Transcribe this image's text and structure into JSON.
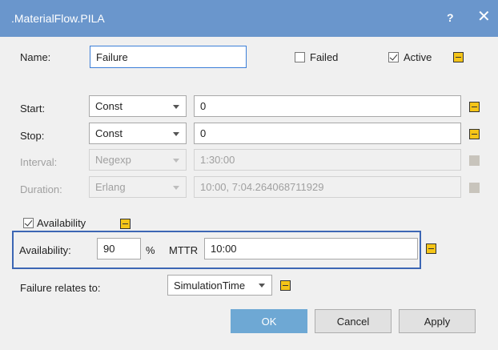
{
  "window": {
    "title": ".MaterialFlow.PILA",
    "help_label": "?",
    "close_label": "✕"
  },
  "name": {
    "label": "Name:",
    "value": "Failure"
  },
  "failed": {
    "label": "Failed",
    "checked": false
  },
  "active": {
    "label": "Active",
    "checked": true
  },
  "start": {
    "label": "Start:",
    "mode": "Const",
    "value": "0"
  },
  "stop": {
    "label": "Stop:",
    "mode": "Const",
    "value": "0"
  },
  "interval": {
    "label": "Interval:",
    "mode": "Negexp",
    "value": "1:30:00"
  },
  "duration": {
    "label": "Duration:",
    "mode": "Erlang",
    "value": "10:00, 7:04.264068711929"
  },
  "availability_check": {
    "label": "Availability",
    "checked": true
  },
  "availability": {
    "label": "Availability:",
    "value": "90",
    "unit": "%",
    "mttr_label": "MTTR",
    "mttr_value": "10:00"
  },
  "relates": {
    "label": "Failure relates to:",
    "value": "SimulationTime"
  },
  "buttons": {
    "ok": "OK",
    "cancel": "Cancel",
    "apply": "Apply"
  },
  "colors": {
    "titlebar": "#6a96cc",
    "marker": "#f5c518",
    "highlight": "#3c66b4",
    "ok_button": "#6ea8d4"
  }
}
